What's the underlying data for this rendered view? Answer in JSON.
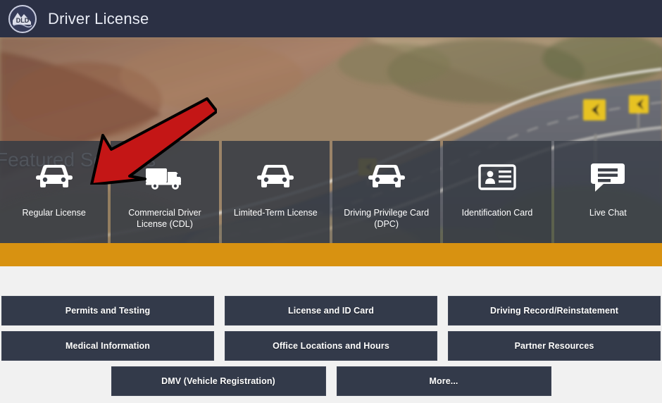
{
  "header": {
    "title": "Driver License",
    "logo_text": "DLD",
    "logo_name": "dld-seal-logo"
  },
  "hero": {
    "caption": "Featured Services",
    "annotation": "red-arrow-pointing-to-regular-license"
  },
  "featured_services": [
    {
      "label": "Regular License",
      "icon": "car-front-icon"
    },
    {
      "label": "Commercial Driver License (CDL)",
      "icon": "truck-icon"
    },
    {
      "label": "Limited-Term License",
      "icon": "car-front-icon"
    },
    {
      "label": "Driving Privilege Card (DPC)",
      "icon": "car-front-icon"
    },
    {
      "label": "Identification Card",
      "icon": "id-card-icon"
    },
    {
      "label": "Live Chat",
      "icon": "chat-bubble-icon"
    }
  ],
  "nav_rows": [
    [
      "Permits and Testing",
      "License and ID Card",
      "Driving Record/Reinstatement"
    ],
    [
      "Medical Information",
      "Office Locations and Hours",
      "Partner Resources"
    ],
    [
      "DMV (Vehicle Registration)",
      "More..."
    ]
  ],
  "colors": {
    "header_bg": "#2b3044",
    "tile_bg": "#383c44",
    "gold": "#d89211",
    "button_bg": "#333a4a",
    "arrow_red": "#c41616",
    "page_bg": "#f1f1f1"
  }
}
